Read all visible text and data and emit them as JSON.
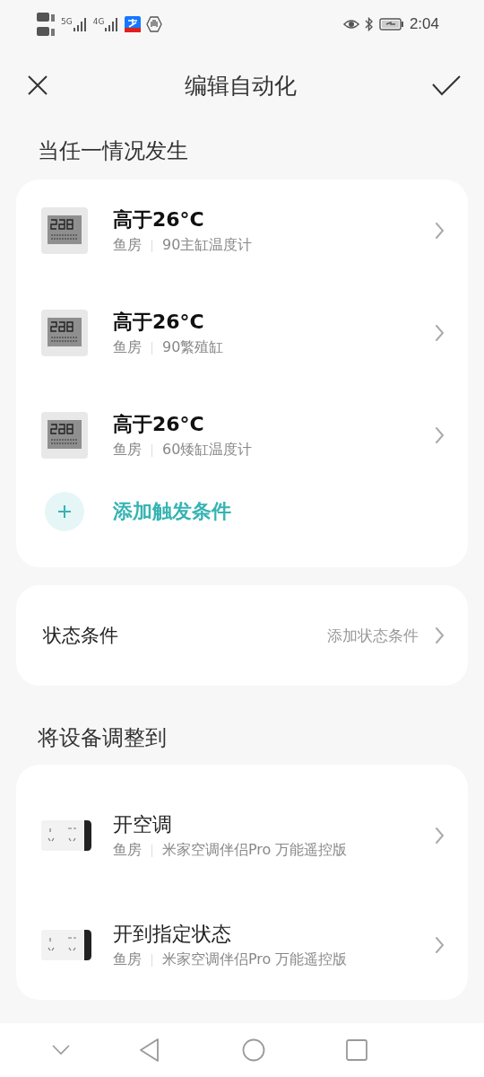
{
  "status_bar": {
    "networks": [
      "5G",
      "4G"
    ],
    "time": "2:04"
  },
  "header": {
    "title": "编辑自动化"
  },
  "triggers": {
    "heading": "当任一情况发生",
    "items": [
      {
        "kind": "thermometer",
        "title": "高于26°C",
        "room": "鱼房",
        "device": "90主缸温度计"
      },
      {
        "kind": "thermometer",
        "title": "高于26°C",
        "room": "鱼房",
        "device": "90繁殖缸"
      },
      {
        "kind": "thermometer",
        "title": "高于26°C",
        "room": "鱼房",
        "device": "60矮缸温度计"
      }
    ],
    "add_label": "添加触发条件"
  },
  "conditions": {
    "label": "状态条件",
    "action": "添加状态条件"
  },
  "actions": {
    "heading": "将设备调整到",
    "items": [
      {
        "kind": "remote",
        "title": "开空调",
        "room": "鱼房",
        "device": "米家空调伴侣Pro 万能遥控版"
      },
      {
        "kind": "remote",
        "title": "开到指定状态",
        "room": "鱼房",
        "device": "米家空调伴侣Pro 万能遥控版"
      }
    ]
  }
}
